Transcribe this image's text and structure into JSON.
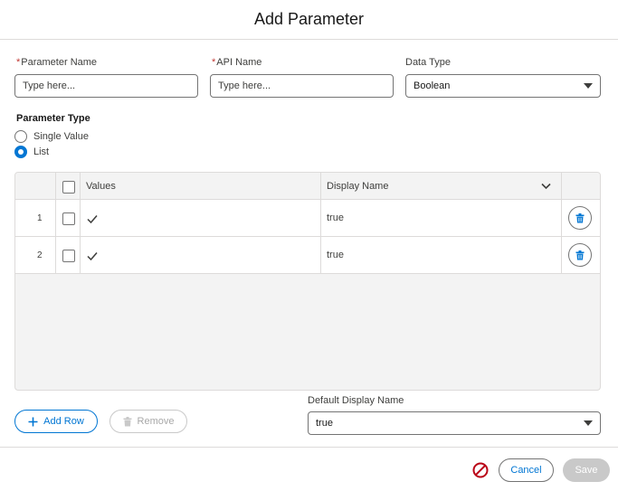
{
  "modal": {
    "title": "Add Parameter"
  },
  "form": {
    "param_name": {
      "label": "Parameter Name",
      "required": "*",
      "placeholder": "Type here..."
    },
    "api_name": {
      "label": "API Name",
      "required": "*",
      "placeholder": "Type here..."
    },
    "data_type": {
      "label": "Data Type",
      "value": "Boolean"
    }
  },
  "param_type": {
    "title": "Parameter Type",
    "options": [
      {
        "label": "Single Value",
        "checked": false
      },
      {
        "label": "List",
        "checked": true
      }
    ]
  },
  "table": {
    "headers": {
      "values": "Values",
      "display_name": "Display Name"
    },
    "rows": [
      {
        "num": "1",
        "display": "true"
      },
      {
        "num": "2",
        "display": "true"
      }
    ]
  },
  "actions": {
    "add_row": "Add Row",
    "remove": "Remove"
  },
  "default_display": {
    "label": "Default Display Name",
    "value": "true"
  },
  "footer": {
    "cancel": "Cancel",
    "save": "Save"
  },
  "colors": {
    "brand": "#0176d3",
    "required": "#c23934",
    "error_icon": "#ba0517",
    "disabled": "#c9c9c9"
  }
}
